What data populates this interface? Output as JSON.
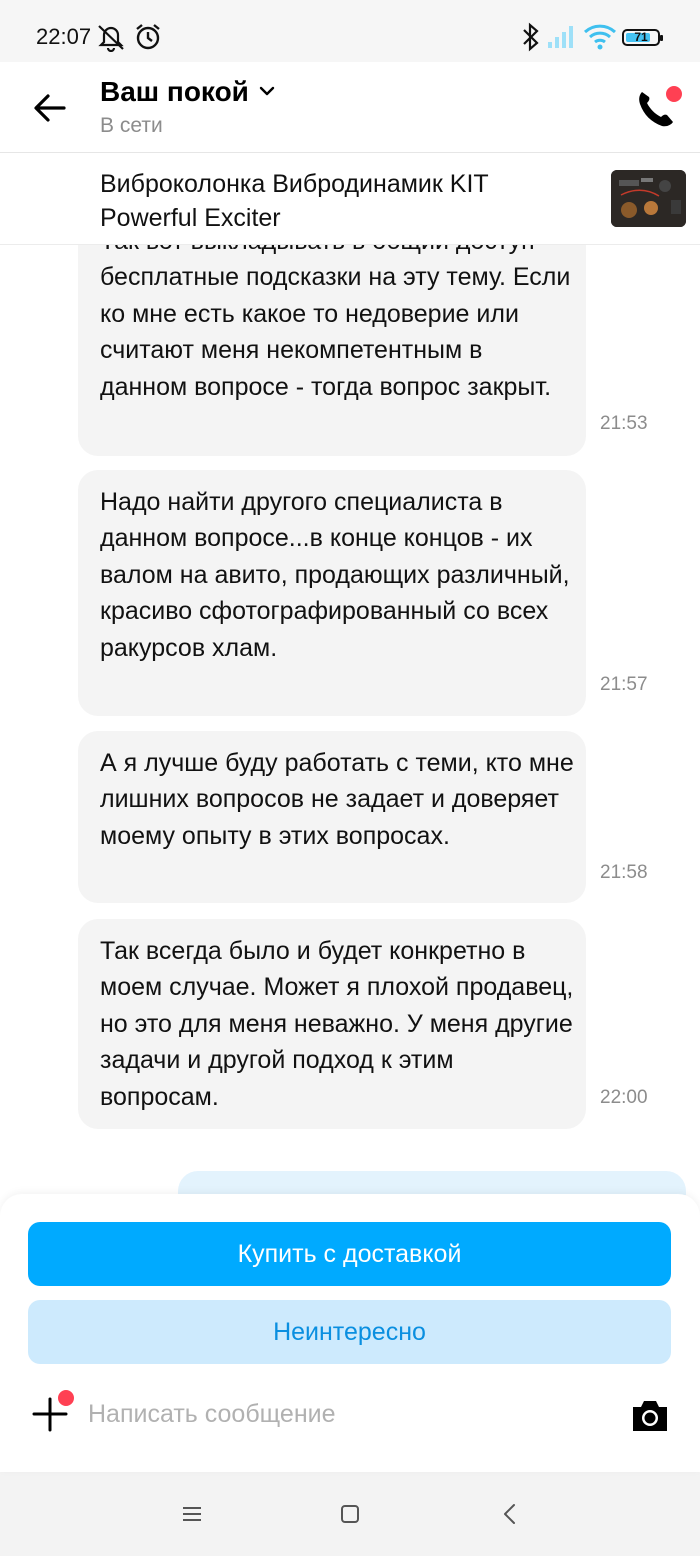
{
  "status_bar": {
    "time": "22:07",
    "battery_level": "71",
    "icons": [
      "mute-icon",
      "alarm-icon",
      "bluetooth-icon",
      "signal-icon",
      "wifi-icon",
      "battery-icon"
    ]
  },
  "header": {
    "title": "Ваш покой",
    "status": "В сети"
  },
  "product": {
    "title": "Виброколонка Вибродинамик KIT Powerful Exciter"
  },
  "messages": [
    {
      "text": "Так вот выкладывать в общий доступ бесплатные подсказки на эту тему. Если ко мне есть какое то недоверие или считают меня некомпетентным в данном вопросе - тогда вопрос закрыт.",
      "time": "21:53"
    },
    {
      "text": "Надо найти другого специалиста в данном вопросе...в конце концов - их валом на авито, продающих различный, красиво сфотографированный со всех ракурсов хлам.",
      "time": "21:57"
    },
    {
      "text": "А я лучше буду работать с теми, кто мне лишних вопросов не задает и доверяет моему опыту в этих вопросах.",
      "time": "21:58"
    },
    {
      "text": "Так всегда было и будет конкретно в моем случае. Может я плохой продавец, но это для меня неважно. У меня другие задачи и другой подход к этим вопросам.",
      "time": "22:00"
    }
  ],
  "actions": {
    "buy_label": "Купить с доставкой",
    "not_interested_label": "Неинтересно"
  },
  "composer": {
    "placeholder": "Написать сообщение"
  },
  "colors": {
    "accent": "#00aaff",
    "secondary_button": "#cdeafd",
    "secondary_text": "#0a8fe0",
    "incoming_bubble": "#f4f4f4",
    "outgoing_bubble": "#e3f3fd",
    "notification_dot": "#ff4053"
  }
}
